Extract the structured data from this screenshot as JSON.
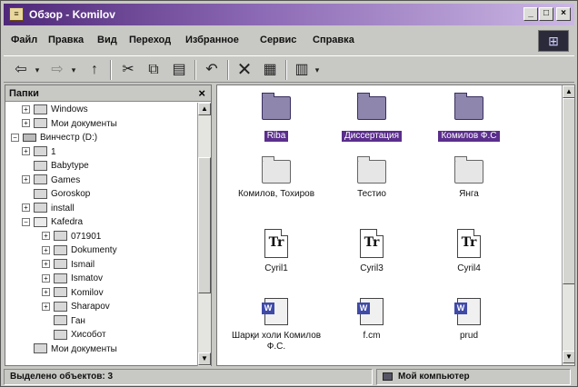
{
  "window": {
    "title": "Обзор - Komilov",
    "app_icon": "explorer-icon",
    "controls": {
      "minimize": "_",
      "maximize": "□",
      "close": "×"
    }
  },
  "menu": [
    {
      "label": "Файл"
    },
    {
      "label": "Правка"
    },
    {
      "label": "Вид"
    },
    {
      "label": "Переход"
    },
    {
      "label": "Избранное"
    },
    {
      "label": "Сервис"
    },
    {
      "label": "Справка"
    }
  ],
  "toolbar": {
    "back": "⇦",
    "forward": "⇨",
    "up": "↑",
    "cut": "✂",
    "copy": "⧉",
    "paste": "▤",
    "undo": "↶",
    "delete": "✕",
    "properties": "▦",
    "views": "▥"
  },
  "folders_pane": {
    "title": "Папки",
    "close": "×",
    "tree": [
      {
        "label": "Windows",
        "expander": "+",
        "kind": "folder",
        "level": 2
      },
      {
        "label": "Мои документы",
        "expander": "+",
        "kind": "folder",
        "level": 2
      },
      {
        "label": "Винчестр (D:)",
        "expander": "−",
        "kind": "drive",
        "level": 1
      },
      {
        "label": "1",
        "expander": "+",
        "kind": "folder",
        "level": 2
      },
      {
        "label": "Babytype",
        "expander": "",
        "kind": "folder",
        "level": 2
      },
      {
        "label": "Games",
        "expander": "+",
        "kind": "folder",
        "level": 2
      },
      {
        "label": "Goroskop",
        "expander": "",
        "kind": "folder",
        "level": 2
      },
      {
        "label": "install",
        "expander": "+",
        "kind": "folder",
        "level": 2
      },
      {
        "label": "Kafedra",
        "expander": "−",
        "kind": "open",
        "level": 2
      },
      {
        "label": "071901",
        "expander": "+",
        "kind": "folder",
        "level": 3
      },
      {
        "label": "Dokumenty",
        "expander": "+",
        "kind": "folder",
        "level": 3
      },
      {
        "label": "Ismail",
        "expander": "+",
        "kind": "folder",
        "level": 3
      },
      {
        "label": "Ismatov",
        "expander": "+",
        "kind": "folder",
        "level": 3
      },
      {
        "label": "Komilov",
        "expander": "+",
        "kind": "folder",
        "level": 3
      },
      {
        "label": "Sharapov",
        "expander": "+",
        "kind": "folder",
        "level": 3
      },
      {
        "label": "Ган",
        "expander": "",
        "kind": "folder",
        "level": 3
      },
      {
        "label": "Хисобот",
        "expander": "",
        "kind": "folder",
        "level": 3
      },
      {
        "label": "Мои документы",
        "expander": "",
        "kind": "folder",
        "level": 2
      }
    ]
  },
  "content_pane": {
    "items": [
      {
        "label": "Riba",
        "type": "folder",
        "selected": true
      },
      {
        "label": "Диссертация",
        "type": "folder",
        "selected": true
      },
      {
        "label": "Комилов Ф.С",
        "type": "folder",
        "selected": true
      },
      {
        "label": "Комилов, Тохиров",
        "type": "folder",
        "selected": false
      },
      {
        "label": "Тестио",
        "type": "folder",
        "selected": false
      },
      {
        "label": "Янга",
        "type": "folder",
        "selected": false
      },
      {
        "label": "Cyril1",
        "type": "font",
        "selected": false
      },
      {
        "label": "Cyril3",
        "type": "font",
        "selected": false
      },
      {
        "label": "Cyril4",
        "type": "font",
        "selected": false
      },
      {
        "label": "Шарқи холи Комилов Ф.С.",
        "type": "word",
        "selected": false
      },
      {
        "label": "f.cm",
        "type": "word",
        "selected": false
      },
      {
        "label": "prud",
        "type": "word",
        "selected": false
      }
    ],
    "font_glyph": "Tr"
  },
  "status": {
    "left": "Выделено объектов: 3",
    "right": "Мой компьютер"
  },
  "colors": {
    "title_start": "#4e2878",
    "title_end": "#cbb7e4",
    "selection": "#5a2e8c",
    "chrome": "#c8c8c4"
  }
}
